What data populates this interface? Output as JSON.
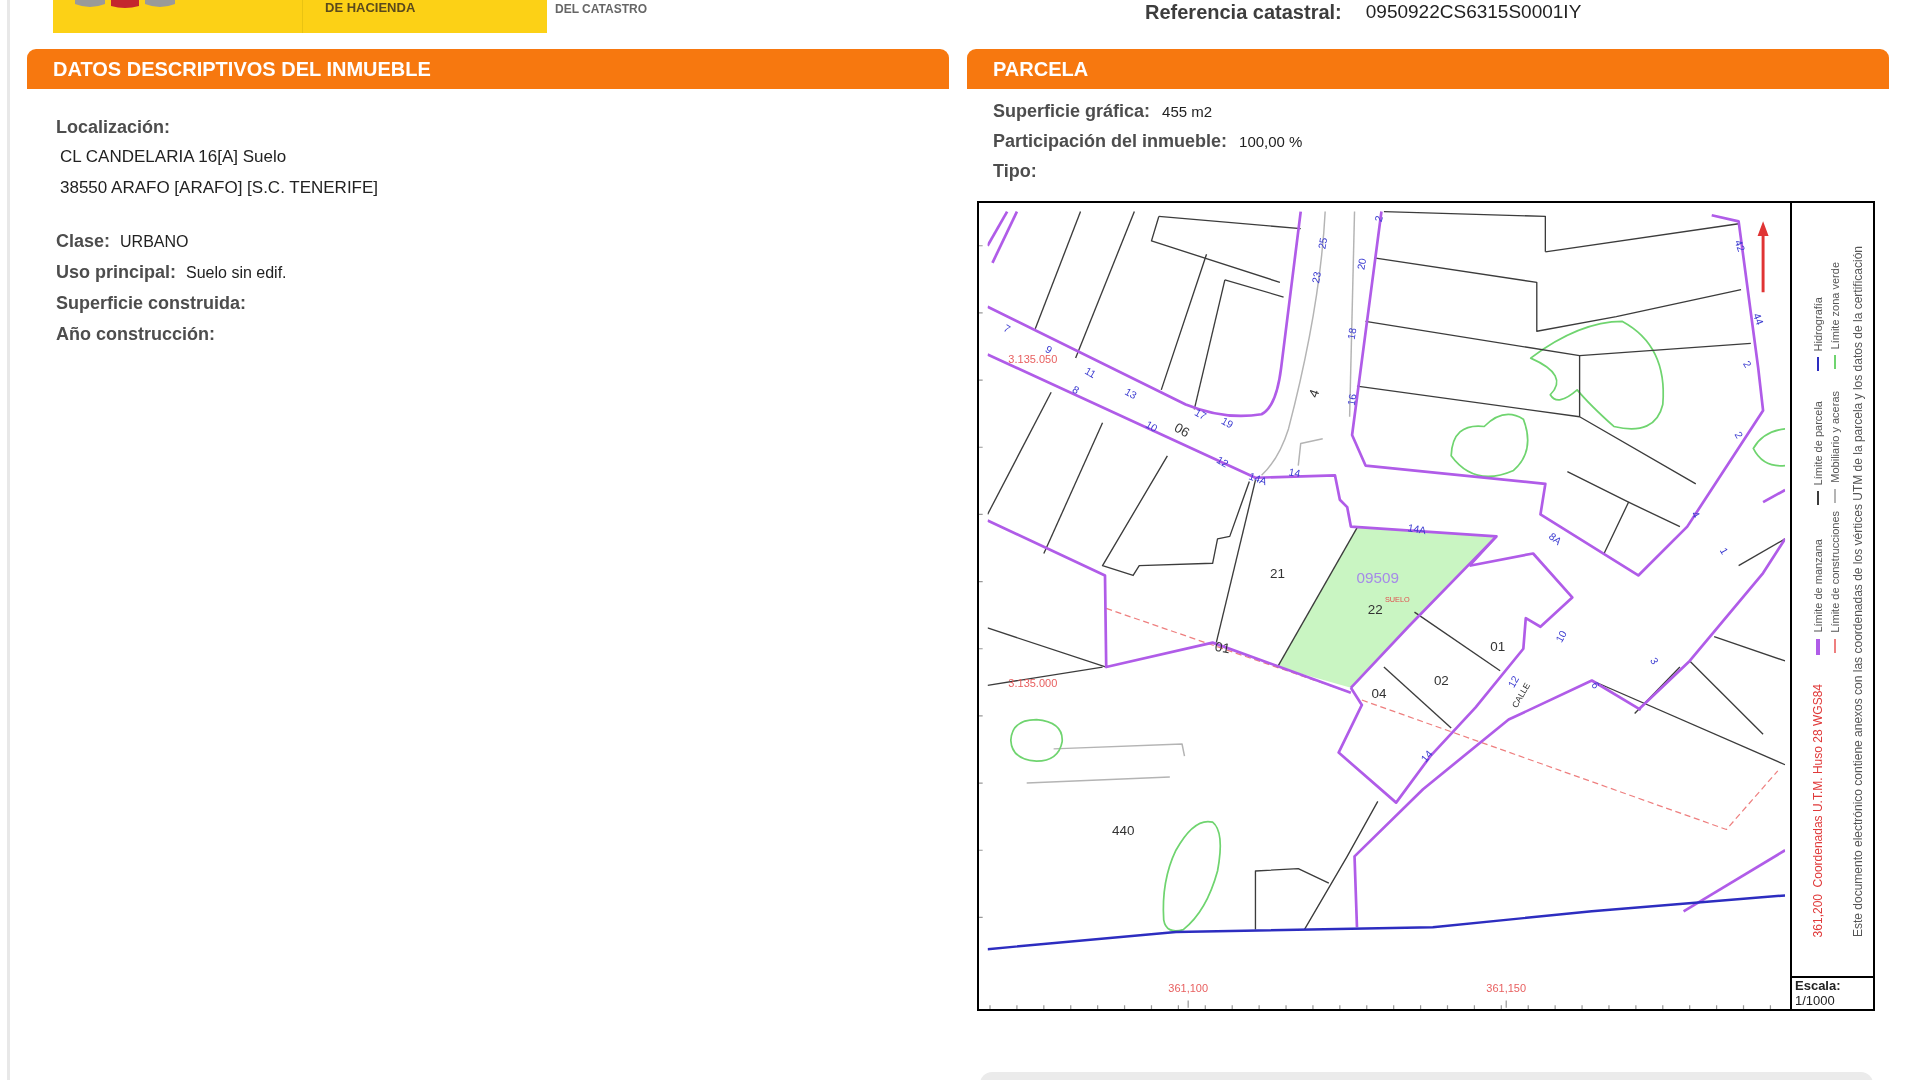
{
  "header": {
    "logo_text": "DE HACIENDA",
    "org_text": "DEL CATASTRO",
    "reference_label": "Referencia catastral:",
    "reference_value": "0950922CS6315S0001IY"
  },
  "descriptive_panel": {
    "title": "DATOS DESCRIPTIVOS DEL INMUEBLE",
    "location_label": "Localización:",
    "address_lines": [
      "CL CANDELARIA 16[A] Suelo",
      "38550 ARAFO [ARAFO] [S.C. TENERIFE]"
    ],
    "fields": [
      {
        "label": "Clase:",
        "value": "URBANO"
      },
      {
        "label": "Uso principal:",
        "value": "Suelo sin edif."
      },
      {
        "label": "Superficie construida:"
      },
      {
        "label": "Año construcción:"
      }
    ]
  },
  "parcel_panel": {
    "title": "PARCELA",
    "fields": [
      {
        "label": "Superficie gráfica:",
        "value": "455 m2"
      },
      {
        "label": "Participación del inmueble:",
        "value": "100,00 %"
      },
      {
        "label": "Tipo:"
      }
    ],
    "map": {
      "labels": [
        {
          "text": "2",
          "kind": "house_number"
        },
        {
          "text": "25",
          "kind": "house_number"
        },
        {
          "text": "42",
          "kind": "house_number"
        },
        {
          "text": "20",
          "kind": "house_number"
        },
        {
          "text": "23",
          "kind": "house_number"
        },
        {
          "text": "44",
          "kind": "house_number"
        },
        {
          "text": "7",
          "kind": "house_number"
        },
        {
          "text": "18",
          "kind": "house_number"
        },
        {
          "text": "9",
          "kind": "house_number"
        },
        {
          "text": "3.135.050",
          "kind": "coordinate"
        },
        {
          "text": "2",
          "kind": "house_number"
        },
        {
          "text": "11",
          "kind": "house_number"
        },
        {
          "text": "8",
          "kind": "house_number"
        },
        {
          "text": "4",
          "kind": "parcel"
        },
        {
          "text": "13",
          "kind": "house_number"
        },
        {
          "text": "16",
          "kind": "house_number"
        },
        {
          "text": "17",
          "kind": "house_number"
        },
        {
          "text": "19",
          "kind": "house_number"
        },
        {
          "text": "10",
          "kind": "house_number"
        },
        {
          "text": "06",
          "kind": "parcel"
        },
        {
          "text": "2",
          "kind": "house_number"
        },
        {
          "text": "12",
          "kind": "house_number"
        },
        {
          "text": "14",
          "kind": "house_number"
        },
        {
          "text": "14A",
          "kind": "house_number"
        },
        {
          "text": "4",
          "kind": "house_number"
        },
        {
          "text": "14A",
          "kind": "house_number"
        },
        {
          "text": "8A",
          "kind": "house_number"
        },
        {
          "text": "1",
          "kind": "house_number"
        },
        {
          "text": "21",
          "kind": "parcel"
        },
        {
          "text": "09509",
          "kind": "parcel_code"
        },
        {
          "text": "SUELO",
          "kind": "land_use"
        },
        {
          "text": "22",
          "kind": "parcel"
        },
        {
          "text": "10",
          "kind": "house_number"
        },
        {
          "text": "01",
          "kind": "parcel"
        },
        {
          "text": "01",
          "kind": "parcel"
        },
        {
          "text": "3",
          "kind": "house_number"
        },
        {
          "text": "02",
          "kind": "parcel"
        },
        {
          "text": "3.135.000",
          "kind": "coordinate"
        },
        {
          "text": "12",
          "kind": "house_number"
        },
        {
          "text": "6",
          "kind": "house_number"
        },
        {
          "text": "CALLE",
          "kind": "street"
        },
        {
          "text": "04",
          "kind": "parcel"
        },
        {
          "text": "14",
          "kind": "house_number"
        },
        {
          "text": "440",
          "kind": "parcel"
        },
        {
          "text": "361,100",
          "kind": "coordinate"
        },
        {
          "text": "361,150",
          "kind": "coordinate"
        }
      ],
      "utm_coordinate": "361,200",
      "utm_label": "Coordenadas U.T.M. Huso 28 WGS84",
      "legend": [
        {
          "label": "Límite de manzana",
          "color": "#b05ce8"
        },
        {
          "label": "Límite de parcela",
          "color": "#3c3c3c"
        },
        {
          "label": "Hidrografía",
          "color": "#2d2dc0"
        },
        {
          "label": "Límite de construcciones",
          "color": "#ee7f7f"
        },
        {
          "label": "Mobiliario y aceras",
          "color": "#b4b4b4"
        },
        {
          "label": "Límite zona verde",
          "color": "#6fd46f"
        }
      ],
      "note": "Este documento electrónico contiene anexos con las coordenadas de los vértices UTM de la parcela y los datos de la certificación",
      "scale_label": "Escala:",
      "scale_value": "1/1000"
    }
  }
}
